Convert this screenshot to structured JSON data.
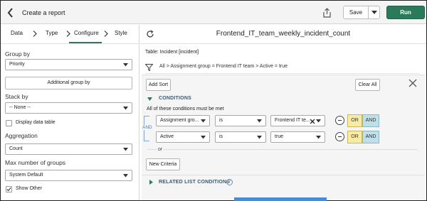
{
  "header": {
    "title": "Create a report",
    "save_label": "Save",
    "run_label": "Run"
  },
  "steps": [
    "Data",
    "Type",
    "Configure",
    "Style"
  ],
  "active_step": "Configure",
  "left_panel": {
    "group_by": {
      "label": "Group by",
      "value": "Priority"
    },
    "additional_group_by_label": "Additional group by",
    "stack_by": {
      "label": "Stack by",
      "value": "-- None --"
    },
    "display_data_table": {
      "label": "Display data table",
      "checked": false
    },
    "aggregation": {
      "label": "Aggregation",
      "value": "Count"
    },
    "max_groups": {
      "label": "Max number of groups",
      "value": "System Default"
    },
    "show_other": {
      "label": "Show Other",
      "checked": true
    }
  },
  "right_panel": {
    "report_title": "Frontend_IT_team_weekly_incident_count",
    "table_label": "Table: Incident [incident]",
    "breadcrumb": "All > Assignment group = Frontend IT team > Active = true",
    "add_sort_label": "Add Sort",
    "clear_all_label": "Clear All",
    "conditions_heading": "CONDITIONS",
    "conditions_note": "All of these conditions must be met",
    "and_connector": "AND",
    "conditions": [
      {
        "field": "Assignment gro...",
        "operator": "is",
        "value": "Frontend IT te...",
        "or_label": "OR",
        "and_label": "AND"
      },
      {
        "field": "Active",
        "operator": "is",
        "value": "true",
        "or_label": "OR",
        "and_label": "AND"
      }
    ],
    "or_text": "or",
    "new_criteria_label": "New Criteria",
    "related_heading": "RELATED LIST CONDITIONS",
    "info_glyph": "?"
  },
  "colors": {
    "run_button": "#2b7a5b",
    "or_button": "#f8eba6",
    "and_button": "#bfe0e8",
    "section_heading": "#2d5f7a"
  }
}
